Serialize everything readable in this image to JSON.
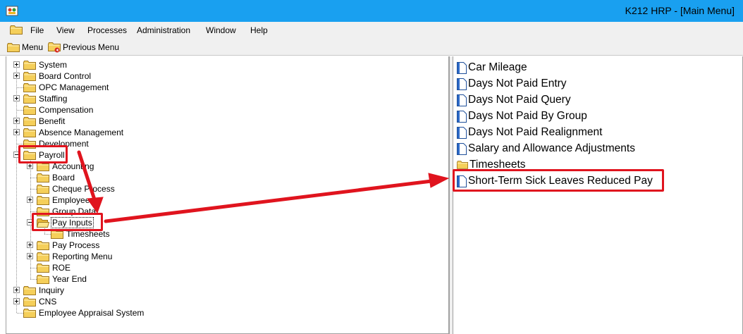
{
  "window": {
    "title": "K212 HRP - [Main Menu]"
  },
  "menubar": {
    "items": [
      "File",
      "View",
      "Processes",
      "Administration",
      "Window",
      "Help"
    ]
  },
  "toolbar": {
    "menu_label": "Menu",
    "previous_menu_label": "Previous Menu"
  },
  "tree": {
    "items": [
      {
        "label": "System",
        "level": 0,
        "expandable": true,
        "expanded": false
      },
      {
        "label": "Board Control",
        "level": 0,
        "expandable": true,
        "expanded": false
      },
      {
        "label": "OPC Management",
        "level": 0,
        "expandable": false
      },
      {
        "label": "Staffing",
        "level": 0,
        "expandable": true,
        "expanded": false
      },
      {
        "label": "Compensation",
        "level": 0,
        "expandable": false
      },
      {
        "label": "Benefit",
        "level": 0,
        "expandable": true,
        "expanded": false
      },
      {
        "label": "Absence Management",
        "level": 0,
        "expandable": true,
        "expanded": false
      },
      {
        "label": "Development",
        "level": 0,
        "expandable": false
      },
      {
        "label": "Payroll",
        "level": 0,
        "expandable": true,
        "expanded": true
      },
      {
        "label": "Accounting",
        "level": 1,
        "expandable": true,
        "expanded": false
      },
      {
        "label": "Board",
        "level": 1,
        "expandable": false
      },
      {
        "label": "Cheque Process",
        "level": 1,
        "expandable": false
      },
      {
        "label": "Employee",
        "level": 1,
        "expandable": true,
        "expanded": false
      },
      {
        "label": "Group Data",
        "level": 1,
        "expandable": false
      },
      {
        "label": "Pay Inputs",
        "level": 1,
        "expandable": true,
        "expanded": true,
        "selected": true
      },
      {
        "label": "Timesheets",
        "level": 2,
        "expandable": false
      },
      {
        "label": "Pay Process",
        "level": 1,
        "expandable": true,
        "expanded": false
      },
      {
        "label": "Reporting Menu",
        "level": 1,
        "expandable": true,
        "expanded": false
      },
      {
        "label": "ROE",
        "level": 1,
        "expandable": false
      },
      {
        "label": "Year End",
        "level": 1,
        "expandable": false
      },
      {
        "label": "Inquiry",
        "level": 0,
        "expandable": true,
        "expanded": false
      },
      {
        "label": "CNS",
        "level": 0,
        "expandable": true,
        "expanded": false
      },
      {
        "label": "Employee Appraisal System",
        "level": 0,
        "expandable": false
      }
    ]
  },
  "right_list": {
    "items": [
      {
        "label": "Car Mileage",
        "icon": "document-icon"
      },
      {
        "label": "Days Not Paid Entry",
        "icon": "document-icon"
      },
      {
        "label": "Days Not Paid Query",
        "icon": "document-icon"
      },
      {
        "label": "Days Not Paid By Group",
        "icon": "document-icon"
      },
      {
        "label": "Days Not Paid Realignment",
        "icon": "document-icon"
      },
      {
        "label": "Salary and Allowance Adjustments",
        "icon": "document-icon"
      },
      {
        "label": "Timesheets",
        "icon": "folder-icon"
      },
      {
        "label": "Short-Term Sick Leaves Reduced Pay",
        "icon": "document-icon",
        "highlighted": true
      }
    ]
  },
  "colors": {
    "titlebar": "#19a0f0",
    "annotation_red": "#e0141e",
    "folder_yellow": "#f5cf5a"
  }
}
